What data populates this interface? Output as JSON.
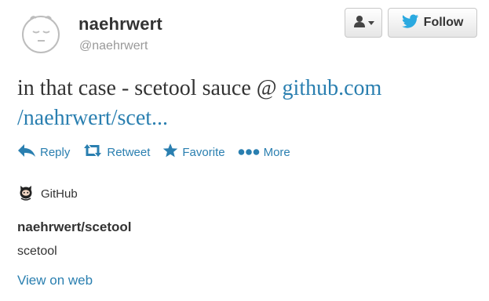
{
  "profile": {
    "display_name": "naehrwert",
    "handle": "@naehrwert",
    "avatar_icon": "sleepy-face-avatar"
  },
  "buttons": {
    "user_menu_icon": "person-icon",
    "follow_label": "Follow"
  },
  "tweet": {
    "text_prefix": "in that case - scetool sauce @ ",
    "link_line1": "github.com",
    "link_line2": "/naehrwert/scet..."
  },
  "actions": [
    {
      "label": "Reply",
      "icon": "reply-icon"
    },
    {
      "label": "Retweet",
      "icon": "retweet-icon"
    },
    {
      "label": "Favorite",
      "icon": "star-icon"
    },
    {
      "label": "More",
      "icon": "more-dots-icon"
    }
  ],
  "card": {
    "source": "GitHub",
    "source_icon": "octocat-icon",
    "title": "naehrwert/scetool",
    "description": "scetool",
    "view_link": "View on web"
  },
  "colors": {
    "link": "#2a7fb0",
    "twitter_bird": "#2aa9e0"
  }
}
